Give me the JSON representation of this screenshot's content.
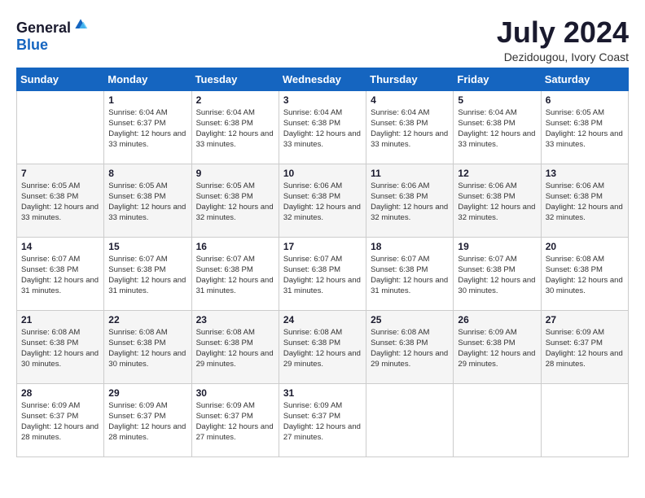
{
  "header": {
    "logo_general": "General",
    "logo_blue": "Blue",
    "month_title": "July 2024",
    "location": "Dezidougou, Ivory Coast"
  },
  "calendar": {
    "days_of_week": [
      "Sunday",
      "Monday",
      "Tuesday",
      "Wednesday",
      "Thursday",
      "Friday",
      "Saturday"
    ],
    "weeks": [
      [
        {
          "day": "",
          "sunrise": "",
          "sunset": "",
          "daylight": ""
        },
        {
          "day": "1",
          "sunrise": "Sunrise: 6:04 AM",
          "sunset": "Sunset: 6:37 PM",
          "daylight": "Daylight: 12 hours and 33 minutes."
        },
        {
          "day": "2",
          "sunrise": "Sunrise: 6:04 AM",
          "sunset": "Sunset: 6:38 PM",
          "daylight": "Daylight: 12 hours and 33 minutes."
        },
        {
          "day": "3",
          "sunrise": "Sunrise: 6:04 AM",
          "sunset": "Sunset: 6:38 PM",
          "daylight": "Daylight: 12 hours and 33 minutes."
        },
        {
          "day": "4",
          "sunrise": "Sunrise: 6:04 AM",
          "sunset": "Sunset: 6:38 PM",
          "daylight": "Daylight: 12 hours and 33 minutes."
        },
        {
          "day": "5",
          "sunrise": "Sunrise: 6:04 AM",
          "sunset": "Sunset: 6:38 PM",
          "daylight": "Daylight: 12 hours and 33 minutes."
        },
        {
          "day": "6",
          "sunrise": "Sunrise: 6:05 AM",
          "sunset": "Sunset: 6:38 PM",
          "daylight": "Daylight: 12 hours and 33 minutes."
        }
      ],
      [
        {
          "day": "7",
          "sunrise": "Sunrise: 6:05 AM",
          "sunset": "Sunset: 6:38 PM",
          "daylight": "Daylight: 12 hours and 33 minutes."
        },
        {
          "day": "8",
          "sunrise": "Sunrise: 6:05 AM",
          "sunset": "Sunset: 6:38 PM",
          "daylight": "Daylight: 12 hours and 33 minutes."
        },
        {
          "day": "9",
          "sunrise": "Sunrise: 6:05 AM",
          "sunset": "Sunset: 6:38 PM",
          "daylight": "Daylight: 12 hours and 32 minutes."
        },
        {
          "day": "10",
          "sunrise": "Sunrise: 6:06 AM",
          "sunset": "Sunset: 6:38 PM",
          "daylight": "Daylight: 12 hours and 32 minutes."
        },
        {
          "day": "11",
          "sunrise": "Sunrise: 6:06 AM",
          "sunset": "Sunset: 6:38 PM",
          "daylight": "Daylight: 12 hours and 32 minutes."
        },
        {
          "day": "12",
          "sunrise": "Sunrise: 6:06 AM",
          "sunset": "Sunset: 6:38 PM",
          "daylight": "Daylight: 12 hours and 32 minutes."
        },
        {
          "day": "13",
          "sunrise": "Sunrise: 6:06 AM",
          "sunset": "Sunset: 6:38 PM",
          "daylight": "Daylight: 12 hours and 32 minutes."
        }
      ],
      [
        {
          "day": "14",
          "sunrise": "Sunrise: 6:07 AM",
          "sunset": "Sunset: 6:38 PM",
          "daylight": "Daylight: 12 hours and 31 minutes."
        },
        {
          "day": "15",
          "sunrise": "Sunrise: 6:07 AM",
          "sunset": "Sunset: 6:38 PM",
          "daylight": "Daylight: 12 hours and 31 minutes."
        },
        {
          "day": "16",
          "sunrise": "Sunrise: 6:07 AM",
          "sunset": "Sunset: 6:38 PM",
          "daylight": "Daylight: 12 hours and 31 minutes."
        },
        {
          "day": "17",
          "sunrise": "Sunrise: 6:07 AM",
          "sunset": "Sunset: 6:38 PM",
          "daylight": "Daylight: 12 hours and 31 minutes."
        },
        {
          "day": "18",
          "sunrise": "Sunrise: 6:07 AM",
          "sunset": "Sunset: 6:38 PM",
          "daylight": "Daylight: 12 hours and 31 minutes."
        },
        {
          "day": "19",
          "sunrise": "Sunrise: 6:07 AM",
          "sunset": "Sunset: 6:38 PM",
          "daylight": "Daylight: 12 hours and 30 minutes."
        },
        {
          "day": "20",
          "sunrise": "Sunrise: 6:08 AM",
          "sunset": "Sunset: 6:38 PM",
          "daylight": "Daylight: 12 hours and 30 minutes."
        }
      ],
      [
        {
          "day": "21",
          "sunrise": "Sunrise: 6:08 AM",
          "sunset": "Sunset: 6:38 PM",
          "daylight": "Daylight: 12 hours and 30 minutes."
        },
        {
          "day": "22",
          "sunrise": "Sunrise: 6:08 AM",
          "sunset": "Sunset: 6:38 PM",
          "daylight": "Daylight: 12 hours and 30 minutes."
        },
        {
          "day": "23",
          "sunrise": "Sunrise: 6:08 AM",
          "sunset": "Sunset: 6:38 PM",
          "daylight": "Daylight: 12 hours and 29 minutes."
        },
        {
          "day": "24",
          "sunrise": "Sunrise: 6:08 AM",
          "sunset": "Sunset: 6:38 PM",
          "daylight": "Daylight: 12 hours and 29 minutes."
        },
        {
          "day": "25",
          "sunrise": "Sunrise: 6:08 AM",
          "sunset": "Sunset: 6:38 PM",
          "daylight": "Daylight: 12 hours and 29 minutes."
        },
        {
          "day": "26",
          "sunrise": "Sunrise: 6:09 AM",
          "sunset": "Sunset: 6:38 PM",
          "daylight": "Daylight: 12 hours and 29 minutes."
        },
        {
          "day": "27",
          "sunrise": "Sunrise: 6:09 AM",
          "sunset": "Sunset: 6:37 PM",
          "daylight": "Daylight: 12 hours and 28 minutes."
        }
      ],
      [
        {
          "day": "28",
          "sunrise": "Sunrise: 6:09 AM",
          "sunset": "Sunset: 6:37 PM",
          "daylight": "Daylight: 12 hours and 28 minutes."
        },
        {
          "day": "29",
          "sunrise": "Sunrise: 6:09 AM",
          "sunset": "Sunset: 6:37 PM",
          "daylight": "Daylight: 12 hours and 28 minutes."
        },
        {
          "day": "30",
          "sunrise": "Sunrise: 6:09 AM",
          "sunset": "Sunset: 6:37 PM",
          "daylight": "Daylight: 12 hours and 27 minutes."
        },
        {
          "day": "31",
          "sunrise": "Sunrise: 6:09 AM",
          "sunset": "Sunset: 6:37 PM",
          "daylight": "Daylight: 12 hours and 27 minutes."
        },
        {
          "day": "",
          "sunrise": "",
          "sunset": "",
          "daylight": ""
        },
        {
          "day": "",
          "sunrise": "",
          "sunset": "",
          "daylight": ""
        },
        {
          "day": "",
          "sunrise": "",
          "sunset": "",
          "daylight": ""
        }
      ]
    ]
  }
}
